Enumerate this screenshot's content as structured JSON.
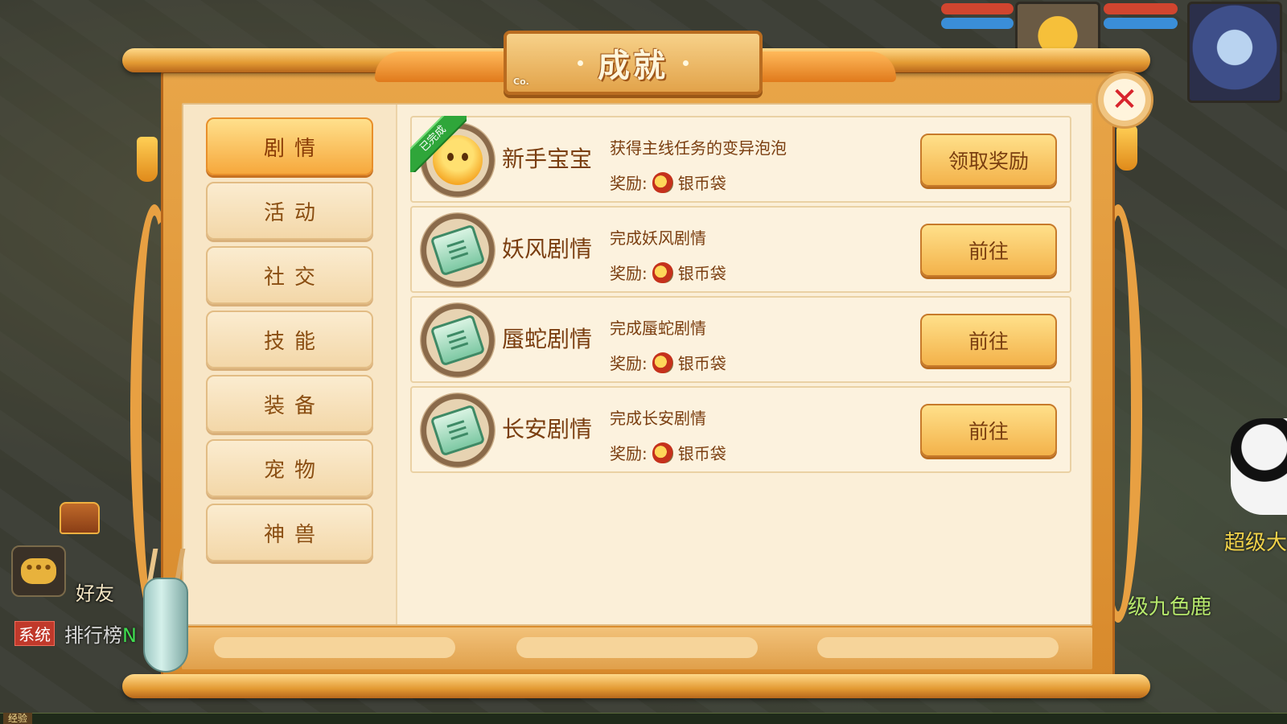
{
  "title": "成就",
  "title_mark": "Co.",
  "tabs": [
    {
      "label": "剧情",
      "active": true
    },
    {
      "label": "活动",
      "active": false
    },
    {
      "label": "社交",
      "active": false
    },
    {
      "label": "技能",
      "active": false
    },
    {
      "label": "装备",
      "active": false
    },
    {
      "label": "宠物",
      "active": false
    },
    {
      "label": "神兽",
      "active": false
    }
  ],
  "achievements": [
    {
      "name": "新手宝宝",
      "desc": "获得主线任务的变异泡泡",
      "reward_label": "奖励:",
      "reward_item": "银币袋",
      "button": "领取奖励",
      "completed": true,
      "badge": "已完成",
      "icon": "pet-face-icon"
    },
    {
      "name": "妖风剧情",
      "desc": "完成妖风剧情",
      "reward_label": "奖励:",
      "reward_item": "银币袋",
      "button": "前往",
      "completed": false,
      "icon": "scroll-icon"
    },
    {
      "name": "蜃蛇剧情",
      "desc": "完成蜃蛇剧情",
      "reward_label": "奖励:",
      "reward_item": "银币袋",
      "button": "前往",
      "completed": false,
      "icon": "scroll-icon"
    },
    {
      "name": "长安剧情",
      "desc": "完成长安剧情",
      "reward_label": "奖励:",
      "reward_item": "银币袋",
      "button": "前往",
      "completed": false,
      "icon": "scroll-icon"
    }
  ],
  "hud": {
    "friend_label": "好友",
    "system_tag": "系统",
    "rank_text": "排行榜",
    "rank_suffix": "N",
    "exp_label": "经验",
    "bg_name_1": "超级大",
    "bg_name_2": "级九色鹿"
  },
  "colors": {
    "accent": "#f6a83c",
    "text_brown": "#7a3e10",
    "completed_green": "#2fa63a",
    "close_red": "#d8242c"
  }
}
